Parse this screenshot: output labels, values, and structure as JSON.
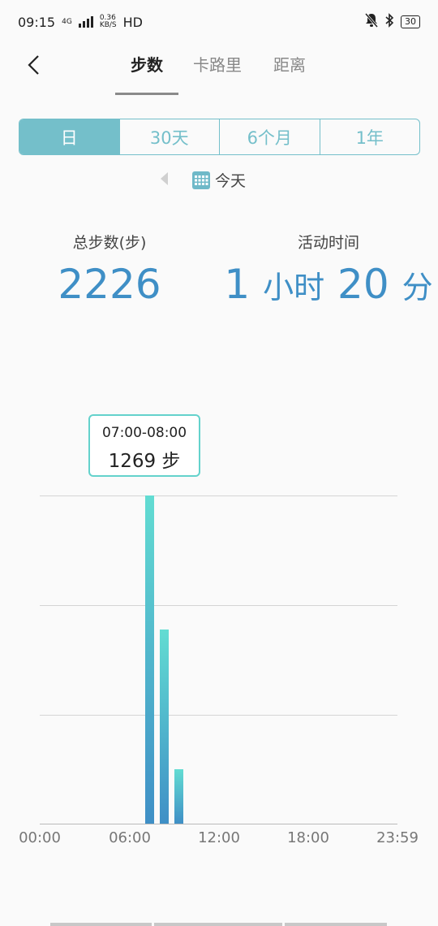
{
  "status_bar": {
    "time": "09:15",
    "net_speed_value": "0.36",
    "net_speed_unit": "KB/S",
    "net_type": "4G",
    "hd_label": "HD",
    "battery": "30"
  },
  "header": {
    "tabs": [
      {
        "label": "步数",
        "active": true
      },
      {
        "label": "卡路里",
        "active": false
      },
      {
        "label": "距离",
        "active": false
      }
    ]
  },
  "period_selector": {
    "options": [
      {
        "label": "日",
        "active": true
      },
      {
        "label": "30天",
        "active": false
      },
      {
        "label": "6个月",
        "active": false
      },
      {
        "label": "1年",
        "active": false
      }
    ]
  },
  "date": {
    "label": "今天"
  },
  "stats": {
    "total_steps_label": "总步数(步)",
    "total_steps_value": "2226",
    "active_time_label": "活动时间",
    "active_hours": "1",
    "hours_unit": "小时",
    "active_minutes": "20",
    "minutes_unit": "分"
  },
  "colors": {
    "accent": "#74bfca",
    "value_blue": "#3f8fc6",
    "bar_top": "#62dcd2",
    "bar_bottom": "#3f8fc6"
  },
  "chart_data": {
    "type": "bar",
    "x_ticks": [
      "00:00",
      "06:00",
      "12:00",
      "18:00",
      "23:59"
    ],
    "x_range": [
      0,
      24
    ],
    "y_range": [
      0,
      1269
    ],
    "gridlines": 3,
    "series": [
      {
        "points": [
          {
            "hour": 7,
            "value": 1269
          },
          {
            "hour": 8,
            "value": 750
          },
          {
            "hour": 9,
            "value": 210
          }
        ]
      }
    ],
    "tooltip": {
      "time": "07:00-08:00",
      "value": "1269",
      "unit": "步"
    }
  }
}
